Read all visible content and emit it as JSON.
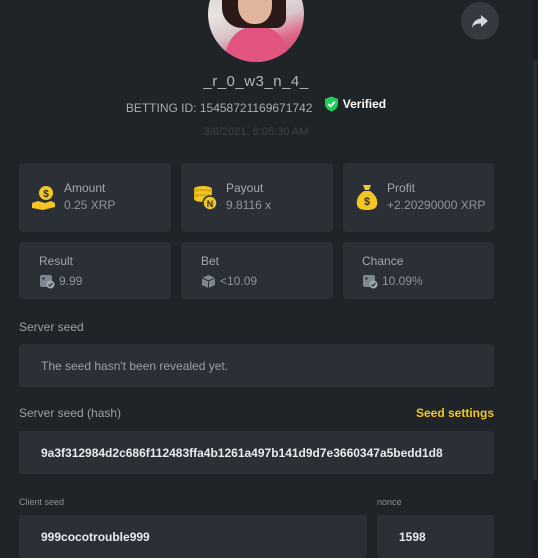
{
  "user": {
    "username": "_r_0_w3_n_4_",
    "betting_id_label": "BETTING ID:",
    "betting_id": "15458721169671742",
    "verified_label": "Verified"
  },
  "timestamp": "3/8/2021, 8:05:30 AM",
  "stats": {
    "amount": {
      "label": "Amount",
      "value": "0.25 XRP",
      "icon": "coin-hand-icon"
    },
    "payout": {
      "label": "Payout",
      "value": "9.8116 x",
      "icon": "coin-stack-icon"
    },
    "profit": {
      "label": "Profit",
      "value": "+2.20290000 XRP",
      "icon": "money-bag-icon"
    },
    "result": {
      "label": "Result",
      "value": "9.99",
      "icon": "dice-check-icon"
    },
    "bet": {
      "label": "Bet",
      "value": "<10.09",
      "icon": "cube-icon"
    },
    "chance": {
      "label": "Chance",
      "value": "10.09%",
      "icon": "dice-check-icon"
    }
  },
  "server_seed": {
    "label": "Server seed",
    "value": "The seed hasn't been revealed yet."
  },
  "server_seed_hash": {
    "label": "Server seed (hash)",
    "settings_label": "Seed settings",
    "value": "9a3f312984d2c686f112483ffa4b1261a497b141d9d7e3660347a5bedd1d8"
  },
  "client_seed": {
    "label": "Client seed",
    "value": "999cocotrouble999"
  },
  "nonce": {
    "label": "nonce",
    "value": "1598"
  },
  "colors": {
    "background": "#1f2429",
    "card": "#2a3036",
    "accent_gold": "#f3c623",
    "verified_green": "#1fcf5a"
  }
}
